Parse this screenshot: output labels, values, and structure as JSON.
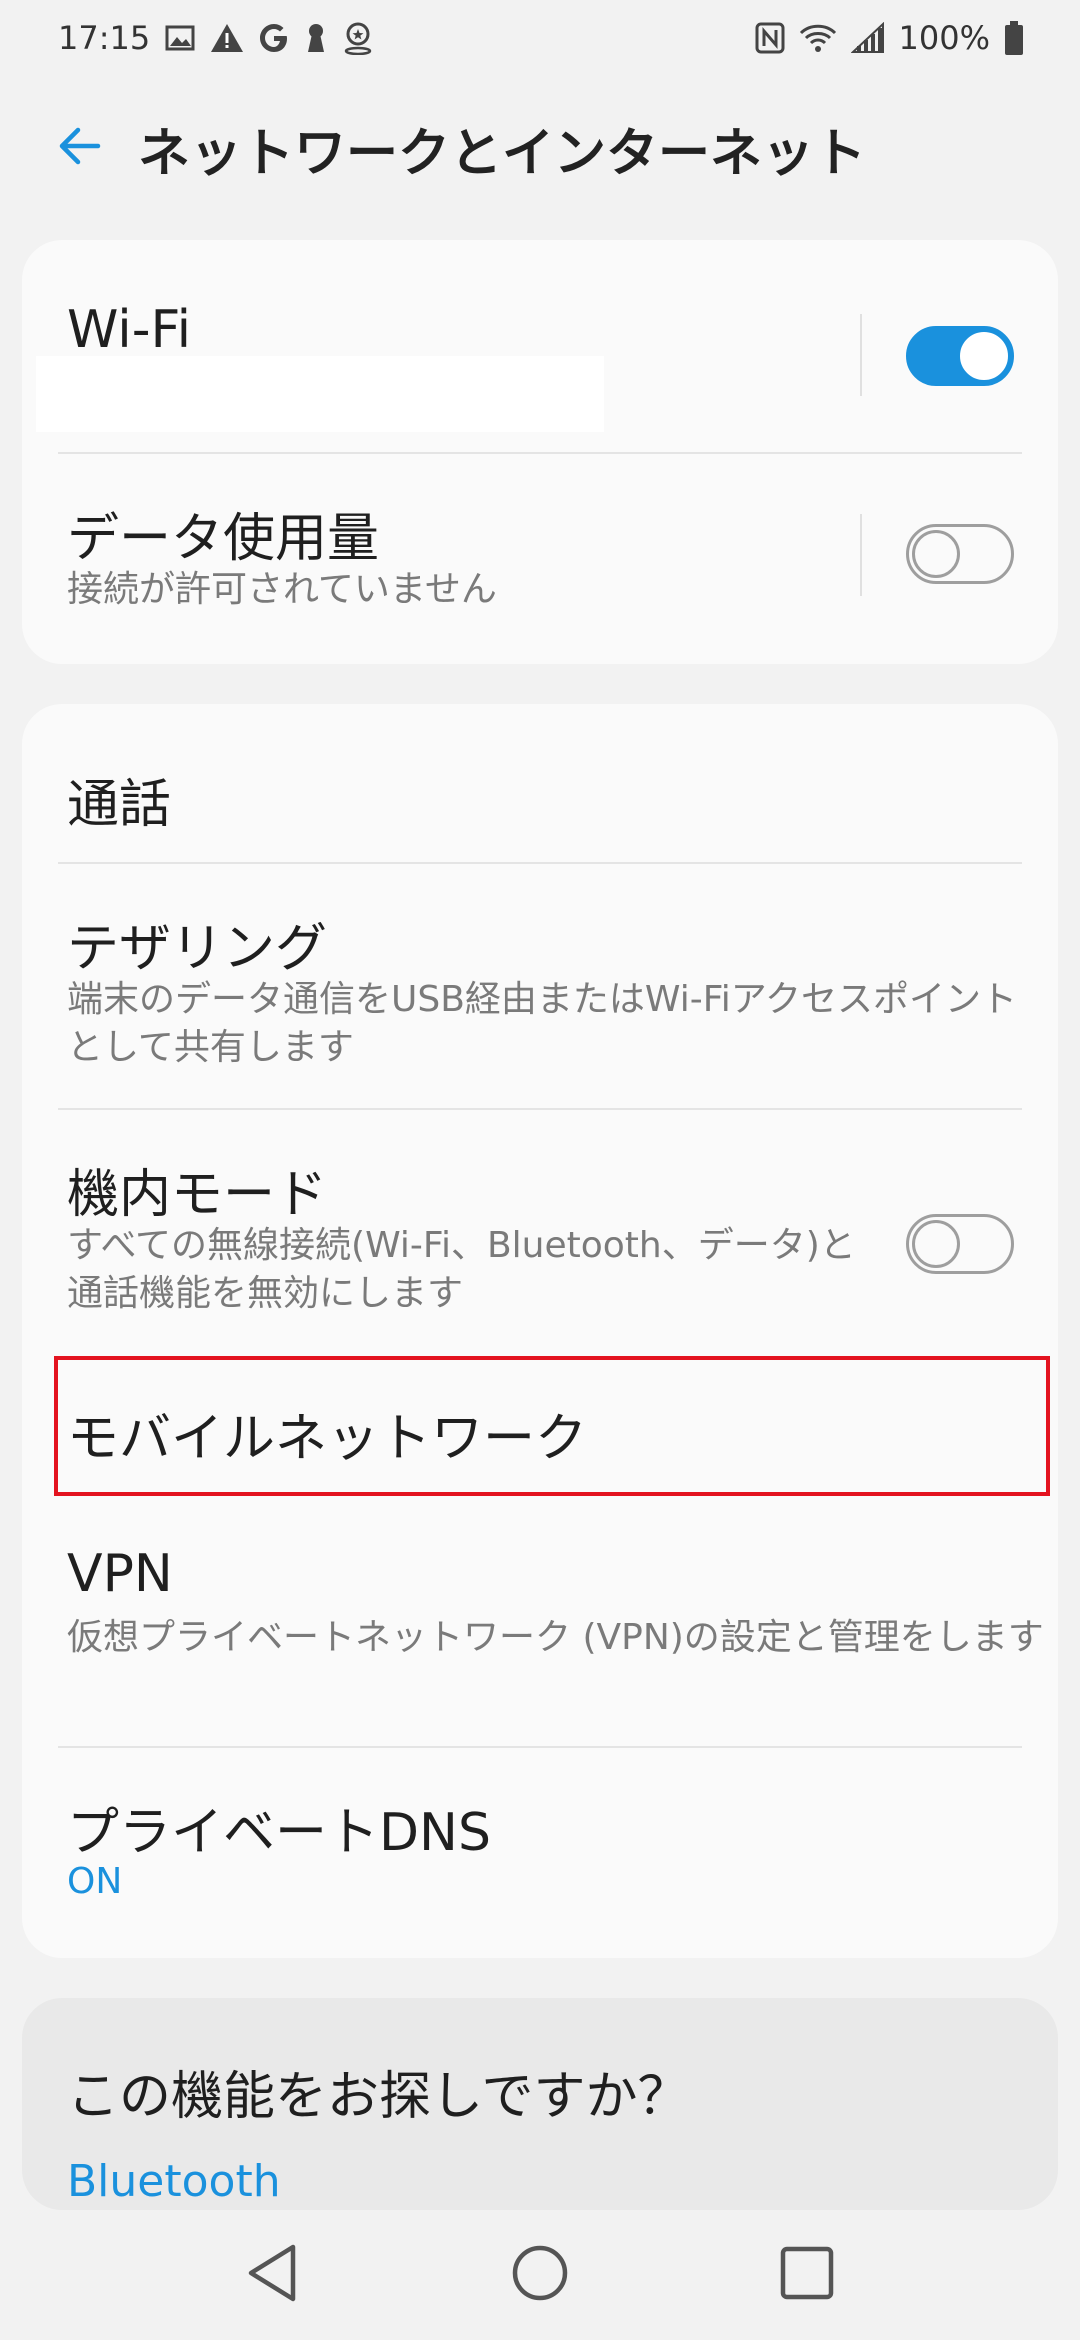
{
  "status_bar": {
    "time": "17:15",
    "battery": "100%",
    "left_icons": [
      "image-icon",
      "warning-icon",
      "google-icon",
      "keyhole-icon",
      "location-pin-icon"
    ],
    "right_icons": [
      "nfc-icon",
      "wifi-icon",
      "signal-icon",
      "battery-icon"
    ]
  },
  "header": {
    "title": "ネットワークとインターネット"
  },
  "card1": {
    "wifi": {
      "title": "Wi-Fi",
      "toggle_on": true
    },
    "data_usage": {
      "title": "データ使用量",
      "subtitle": "接続が許可されていません",
      "toggle_on": false
    }
  },
  "card2": {
    "calls": {
      "title": "通話"
    },
    "tethering": {
      "title": "テザリング",
      "subtitle": "端末のデータ通信をUSB経由またはWi-Fiアクセスポイントとして共有します"
    },
    "airplane": {
      "title": "機内モード",
      "subtitle": "すべての無線接続(Wi-Fi、Bluetooth、データ)と通話機能を無効にします",
      "toggle_on": false
    },
    "mobile_network": {
      "title": "モバイルネットワーク"
    },
    "vpn": {
      "title": "VPN",
      "subtitle": "仮想プライベートネットワーク (VPN)の設定と管理をします"
    },
    "private_dns": {
      "title": "プライベートDNS",
      "status": "ON"
    }
  },
  "card3": {
    "title": "この機能をお探しですか？",
    "link": "Bluetooth"
  },
  "colors": {
    "accent": "#1a91dd",
    "highlight": "#e3131f",
    "background": "#f2f2f2",
    "card": "#fafafa"
  }
}
